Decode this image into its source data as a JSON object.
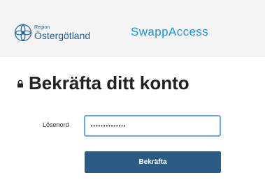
{
  "header": {
    "logo": {
      "region_label": "Region",
      "name": "Östergötland",
      "icon": "region-emblem-icon"
    },
    "brand_name": "SwappAccess"
  },
  "form": {
    "title": "Bekräfta ditt konto",
    "title_icon": "lock-icon",
    "password_label": "Lösenord",
    "password_value": "••••••••••••••",
    "submit_label": "Bekräfta"
  },
  "colors": {
    "header_background": "#f5f5f5",
    "logo_blue": "#1d5f9a",
    "brand_blue": "#1e8fd3",
    "button_background": "#2c5b87",
    "input_focus_border": "#72a7dd"
  }
}
